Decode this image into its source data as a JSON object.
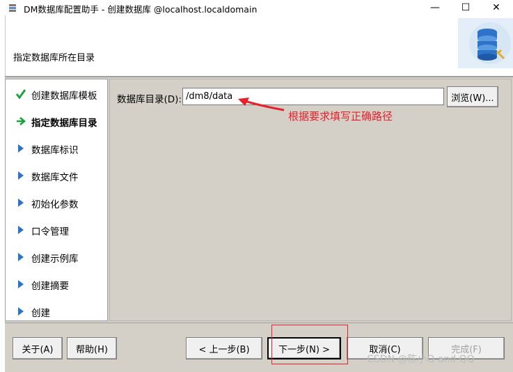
{
  "window": {
    "title": "DM数据库配置助手 - 创建数据库 @localhost.localdomain",
    "minimize_glyph": "—",
    "maximize_glyph": "☐",
    "close_glyph": "✕"
  },
  "header": {
    "title": "指定数据库所在目录",
    "graphic_icon": "database-stack-icon"
  },
  "steps": [
    {
      "label": "创建数据库模板",
      "status": "done",
      "icon": "checkmark-icon"
    },
    {
      "label": "指定数据库目录",
      "status": "current",
      "icon": "arrow-right-icon"
    },
    {
      "label": "数据库标识",
      "status": "pending",
      "icon": "triangle-right-icon"
    },
    {
      "label": "数据库文件",
      "status": "pending",
      "icon": "triangle-right-icon"
    },
    {
      "label": "初始化参数",
      "status": "pending",
      "icon": "triangle-right-icon"
    },
    {
      "label": "口令管理",
      "status": "pending",
      "icon": "triangle-right-icon"
    },
    {
      "label": "创建示例库",
      "status": "pending",
      "icon": "triangle-right-icon"
    },
    {
      "label": "创建摘要",
      "status": "pending",
      "icon": "triangle-right-icon"
    },
    {
      "label": "创建",
      "status": "pending",
      "icon": "triangle-right-icon"
    }
  ],
  "form": {
    "dir_label": "数据库目录(D):",
    "dir_value": "/dm8/data",
    "browse_label": "浏览(W)..."
  },
  "annotation": {
    "text": "根据要求填写正确路径",
    "color": "#e8202a"
  },
  "buttons": {
    "about": "关于(A)",
    "help": "帮助(H)",
    "prev": "< 上一步(B)",
    "next": "下一步(N) >",
    "cancel": "取消(C)",
    "finish": "完成(F)"
  },
  "watermark": "CSDN @陈小Q and QQ",
  "colors": {
    "check_green": "#1aa33a",
    "arrow_green": "#1aa33a",
    "triangle_blue": "#2f73c8"
  }
}
